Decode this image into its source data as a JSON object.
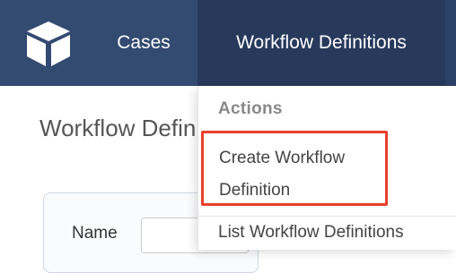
{
  "nav": {
    "logo_icon": "cube-icon",
    "items": [
      {
        "label": "Cases"
      },
      {
        "label": "Workflow Definitions",
        "active": true
      }
    ]
  },
  "page": {
    "title": "Workflow Definitions"
  },
  "form": {
    "name_label": "Name",
    "name_value": ""
  },
  "dropdown": {
    "header": "Actions",
    "items": [
      {
        "label": "Create Workflow Definition",
        "highlighted": true
      },
      {
        "label": "List Workflow Definitions"
      }
    ]
  },
  "colors": {
    "navbar": "#334a71",
    "navbar_active": "#273a5c",
    "highlight_border": "#e8402c"
  }
}
